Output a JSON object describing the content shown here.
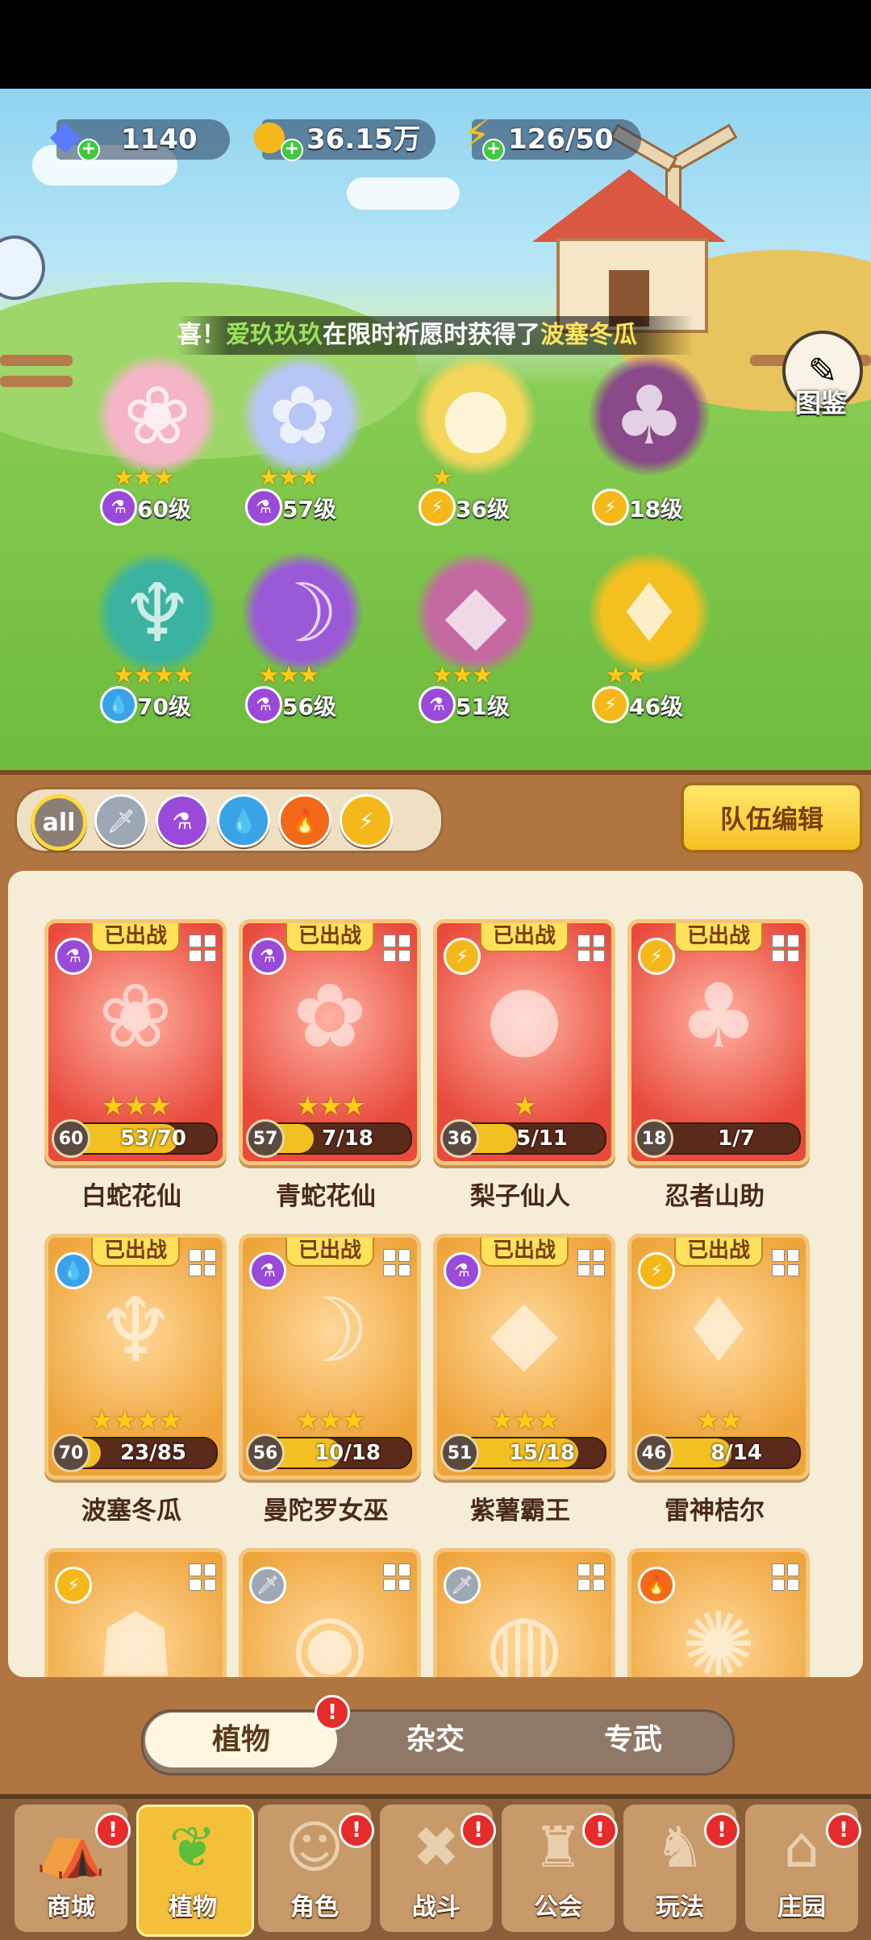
{
  "resources": {
    "gems": "1140",
    "gold": "36.15万",
    "energy": "126/50"
  },
  "ticker": {
    "prefix": "喜！",
    "player": "爱玖玖玖",
    "middle": "在限时祈愿时获得了",
    "item": "波塞冬瓜"
  },
  "codex_label": "图鉴",
  "team": [
    {
      "level": "60级",
      "stars": "★★★",
      "element": "purple-potion-icon"
    },
    {
      "level": "57级",
      "stars": "★★★",
      "element": "purple-potion-icon"
    },
    {
      "level": "36级",
      "stars": "★",
      "element": "bolt-icon"
    },
    {
      "level": "18级",
      "stars": "",
      "element": "bolt-icon"
    },
    {
      "level": "70级",
      "stars": "★★★★",
      "element": "water-drop-icon"
    },
    {
      "level": "56级",
      "stars": "★★★",
      "element": "purple-potion-icon"
    },
    {
      "level": "51级",
      "stars": "★★★",
      "element": "purple-potion-icon"
    },
    {
      "level": "46级",
      "stars": "★★",
      "element": "bolt-icon"
    }
  ],
  "filters": {
    "all": "all",
    "items": [
      "sword-icon",
      "purple-potion-icon",
      "water-drop-icon",
      "fire-icon",
      "bolt-icon"
    ]
  },
  "team_edit_label": "队伍编辑",
  "deployed_label": "已出战",
  "cards": [
    {
      "name": "白蛇花仙",
      "level": "60",
      "progress": "53/70",
      "fill": 0.76,
      "stars": "★★★",
      "element": "purple-potion-icon",
      "style": "red",
      "deployed": true
    },
    {
      "name": "青蛇花仙",
      "level": "57",
      "progress": "7/18",
      "fill": 0.39,
      "stars": "★★★",
      "element": "purple-potion-icon",
      "style": "red",
      "deployed": true
    },
    {
      "name": "梨子仙人",
      "level": "36",
      "progress": "5/11",
      "fill": 0.45,
      "stars": "★",
      "element": "bolt-icon",
      "style": "red",
      "deployed": true
    },
    {
      "name": "忍者山助",
      "level": "18",
      "progress": "1/7",
      "fill": 0.14,
      "stars": "",
      "element": "bolt-icon",
      "style": "red",
      "deployed": true
    },
    {
      "name": "波塞冬瓜",
      "level": "70",
      "progress": "23/85",
      "fill": 0.27,
      "stars": "★★★★",
      "element": "water-drop-icon",
      "style": "orange",
      "deployed": true
    },
    {
      "name": "曼陀罗女巫",
      "level": "56",
      "progress": "10/18",
      "fill": 0.56,
      "stars": "★★★",
      "element": "purple-potion-icon",
      "style": "orange",
      "deployed": true
    },
    {
      "name": "紫薯霸王",
      "level": "51",
      "progress": "15/18",
      "fill": 0.83,
      "stars": "★★★",
      "element": "purple-potion-icon",
      "style": "orange",
      "deployed": true
    },
    {
      "name": "雷神桔尔",
      "level": "46",
      "progress": "8/14",
      "fill": 0.57,
      "stars": "★★",
      "element": "bolt-icon",
      "style": "orange",
      "deployed": true
    },
    {
      "name": "",
      "level": "",
      "progress": "",
      "fill": 0,
      "stars": "",
      "element": "bolt-icon",
      "style": "orange",
      "deployed": false
    },
    {
      "name": "",
      "level": "",
      "progress": "",
      "fill": 0,
      "stars": "",
      "element": "sword-icon",
      "style": "orange",
      "deployed": false
    },
    {
      "name": "",
      "level": "",
      "progress": "",
      "fill": 0,
      "stars": "",
      "element": "sword-icon",
      "style": "orange",
      "deployed": false
    },
    {
      "name": "",
      "level": "",
      "progress": "",
      "fill": 0,
      "stars": "",
      "element": "fire-icon",
      "style": "orange",
      "deployed": false
    }
  ],
  "segments": {
    "plants": "植物",
    "hybrid": "杂交",
    "weapons": "专武",
    "badge": "!"
  },
  "nav": [
    {
      "label": "商城",
      "icon": "shop-icon"
    },
    {
      "label": "植物",
      "icon": "plant-icon"
    },
    {
      "label": "角色",
      "icon": "character-icon"
    },
    {
      "label": "战斗",
      "icon": "battle-icon"
    },
    {
      "label": "公会",
      "icon": "guild-icon"
    },
    {
      "label": "玩法",
      "icon": "gameplay-icon"
    },
    {
      "label": "庄园",
      "icon": "manor-icon"
    }
  ],
  "colors": {
    "accent": "#f4c03a",
    "panel": "#b07540",
    "panel_inner": "#f6edd8",
    "badge": "#e52b2b"
  }
}
